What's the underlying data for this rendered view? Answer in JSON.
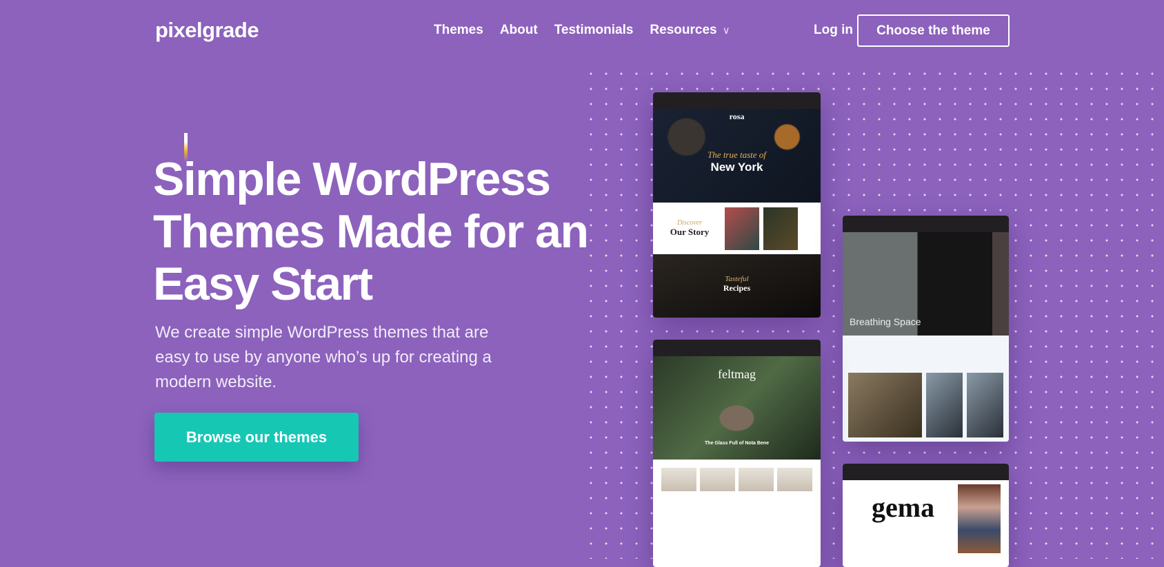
{
  "header": {
    "logo": "pixelgrade",
    "nav": [
      {
        "label": "Themes"
      },
      {
        "label": "About"
      },
      {
        "label": "Testimonials"
      },
      {
        "label": "Resources",
        "icon": "chevron-down-icon"
      }
    ],
    "login": "Log in",
    "cta": "Choose the theme"
  },
  "hero": {
    "title": "Simple WordPress Themes Made for an Easy Start",
    "lead": "We create simple WordPress themes that are easy to use by anyone who’s up for creating a modern website.",
    "button": "Browse our themes"
  },
  "previews": {
    "rosa": {
      "name": "rosa",
      "script": "The true taste of",
      "title": "New York",
      "story_script": "Discover",
      "story": "Our Story",
      "recipes_script": "Tasteful",
      "recipes": "Recipes"
    },
    "second": {
      "title": "Breathing Space"
    },
    "felt": {
      "name": "feltmag",
      "headline": "The Glass Full of Nota Bene"
    },
    "gema": {
      "name": "gema"
    }
  },
  "colors": {
    "background": "#8c62bd",
    "accent": "#16c7b4"
  }
}
